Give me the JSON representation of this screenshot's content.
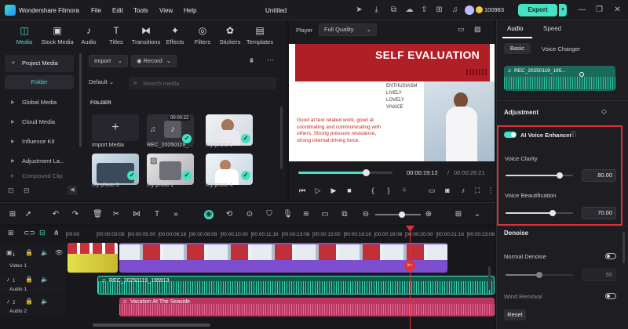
{
  "app": {
    "name": "Wondershare Filmora",
    "menu": [
      "File",
      "Edit",
      "Tools",
      "View",
      "Help"
    ],
    "doc_title": "Untitled",
    "credits": "100983",
    "export_label": "Export"
  },
  "media": {
    "categories": [
      "Media",
      "Stock Media",
      "Audio",
      "Titles",
      "Transitions",
      "Effects",
      "Filters",
      "Stickers",
      "Templates"
    ],
    "sidebar": [
      "Project Media",
      "Global Media",
      "Cloud Media",
      "Influence Kit",
      "Adjustment La...",
      "Compound Clip"
    ],
    "folder_button": "Folder",
    "import_label": "Import",
    "record_label": "Record",
    "sort_label": "Default",
    "search_placeholder": "Search media",
    "folder_heading": "FOLDER",
    "items": [
      {
        "label": "Import Media"
      },
      {
        "label": "REC_20250119_...",
        "duration": "00:00:22"
      },
      {
        "label": "my photo 5"
      },
      {
        "label": "my photo 3"
      },
      {
        "label": "my photo 2"
      },
      {
        "label": "my photo 4"
      }
    ]
  },
  "player": {
    "label": "Player",
    "quality": "Full Quality",
    "slide_title": "SELF EVALUATION",
    "slide_list": [
      "ENTHUSIASM",
      "LIVELY",
      "LOVELY",
      "VIVACE"
    ],
    "slide_body": "Good at text related work, good at coordinating and communicating with others. Strong pressure resistance, strong internal driving force.",
    "current_time": "00:00:19:12",
    "total_time": "00:00:26:21",
    "progress": 0.72
  },
  "right": {
    "tabs": [
      "Audio",
      "Speed"
    ],
    "subtabs": [
      "Basic",
      "Voice Changer"
    ],
    "clip_name": "REC_20250119_195...",
    "adjustment": "Adjustment",
    "enhancer": "AI Voice Enhancer",
    "voice_clarity": {
      "label": "Voice Clarity",
      "value": "80.00",
      "level": 0.8
    },
    "voice_beautification": {
      "label": "Voice Beautification",
      "value": "70.00",
      "level": 0.7
    },
    "denoise": "Denoise",
    "normal_denoise": {
      "label": "Normal Denoise",
      "value": "50",
      "level": 0.5
    },
    "wind_removal": "Wind Removal",
    "reset": "Reset"
  },
  "timeline": {
    "ticks": [
      "00:00",
      "00:00:03:08",
      "00:00:05:00",
      "00:00:06:16",
      "00:00:08:08",
      "00:00:10:00",
      "00:00:11:16",
      "00:00:13:08",
      "00:00:15:00",
      "00:00:16:16",
      "00:00:18:08",
      "00:00:20:00",
      "00:00:21:16",
      "00:00:23:08"
    ],
    "tracks": [
      "Video 1",
      "Audio 1",
      "Audio 2"
    ],
    "track_nums": [
      "1",
      "1",
      "2"
    ],
    "audio_clip_1": "REC_20250119_195913",
    "audio_clip_2": "Vacation At The Seaside"
  },
  "colors": {
    "accent": "#46e0c2",
    "highlight": "#e0303a",
    "video": "#8a5bd6",
    "audio1": "#2fb898",
    "audio2": "#d9456e"
  }
}
